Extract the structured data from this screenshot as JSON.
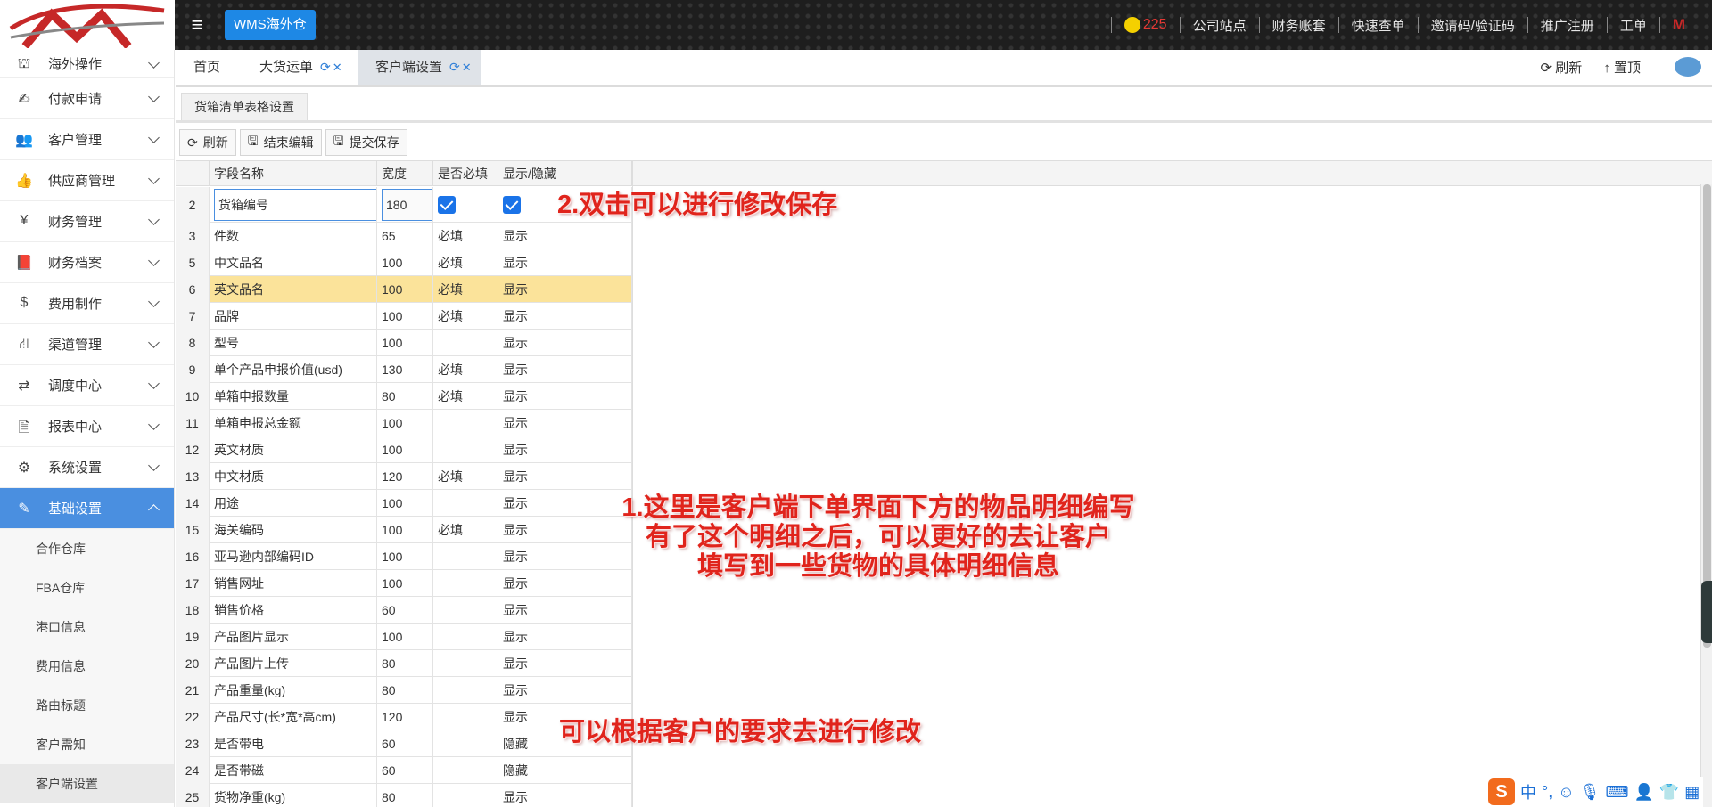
{
  "topbar": {
    "app_badge": "WMS海外仓",
    "notify_count": "225",
    "links": [
      "公司站点",
      "财务账套",
      "快速查单",
      "邀请码/验证码",
      "推广注册",
      "工单"
    ],
    "user_mark": "M"
  },
  "sidebar": {
    "items": [
      {
        "label": "海外操作",
        "icon": "customs-icon"
      },
      {
        "label": "付款申请",
        "icon": "payment-icon"
      },
      {
        "label": "客户管理",
        "icon": "users-icon"
      },
      {
        "label": "供应商管理",
        "icon": "thumbs-up-icon"
      },
      {
        "label": "财务管理",
        "icon": "yen-icon"
      },
      {
        "label": "财务档案",
        "icon": "book-icon"
      },
      {
        "label": "费用制作",
        "icon": "dollar-icon"
      },
      {
        "label": "渠道管理",
        "icon": "road-icon"
      },
      {
        "label": "调度中心",
        "icon": "retweet-icon"
      },
      {
        "label": "报表中心",
        "icon": "file-icon"
      },
      {
        "label": "系统设置",
        "icon": "gear-icon"
      },
      {
        "label": "基础设置",
        "icon": "edit-icon"
      }
    ],
    "subitems": [
      "合作仓库",
      "FBA仓库",
      "港口信息",
      "费用信息",
      "路由标题",
      "客户需知",
      "客户端设置"
    ]
  },
  "tabs": {
    "items": [
      "首页",
      "大货运单",
      "客户端设置"
    ],
    "refresh_label": "刷新",
    "top_label": "置顶"
  },
  "panel": {
    "title": "货箱清单表格设置",
    "toolbar": {
      "refresh": "刷新",
      "end_edit": "结束编辑",
      "save": "提交保存"
    }
  },
  "grid": {
    "headers": [
      "字段名称",
      "宽度",
      "是否必填",
      "显示/隐藏"
    ],
    "edit_row": {
      "num": "2",
      "name": "货箱编号",
      "width": "180",
      "required": true,
      "visible": true
    },
    "rows": [
      {
        "num": "3",
        "name": "件数",
        "width": "65",
        "required": "必填",
        "visible": "显示"
      },
      {
        "num": "5",
        "name": "中文品名",
        "width": "100",
        "required": "必填",
        "visible": "显示"
      },
      {
        "num": "6",
        "name": "英文品名",
        "width": "100",
        "required": "必填",
        "visible": "显示"
      },
      {
        "num": "7",
        "name": "品牌",
        "width": "100",
        "required": "必填",
        "visible": "显示"
      },
      {
        "num": "8",
        "name": "型号",
        "width": "100",
        "required": "",
        "visible": "显示"
      },
      {
        "num": "9",
        "name": "单个产品申报价值(usd)",
        "width": "130",
        "required": "必填",
        "visible": "显示"
      },
      {
        "num": "10",
        "name": "单箱申报数量",
        "width": "80",
        "required": "必填",
        "visible": "显示"
      },
      {
        "num": "11",
        "name": "单箱申报总金额",
        "width": "100",
        "required": "",
        "visible": "显示"
      },
      {
        "num": "12",
        "name": "英文材质",
        "width": "100",
        "required": "",
        "visible": "显示"
      },
      {
        "num": "13",
        "name": "中文材质",
        "width": "120",
        "required": "必填",
        "visible": "显示"
      },
      {
        "num": "14",
        "name": "用途",
        "width": "100",
        "required": "",
        "visible": "显示"
      },
      {
        "num": "15",
        "name": "海关编码",
        "width": "100",
        "required": "必填",
        "visible": "显示"
      },
      {
        "num": "16",
        "name": "亚马逊内部编码ID",
        "width": "100",
        "required": "",
        "visible": "显示"
      },
      {
        "num": "17",
        "name": "销售网址",
        "width": "100",
        "required": "",
        "visible": "显示"
      },
      {
        "num": "18",
        "name": "销售价格",
        "width": "60",
        "required": "",
        "visible": "显示"
      },
      {
        "num": "19",
        "name": "产品图片显示",
        "width": "100",
        "required": "",
        "visible": "显示"
      },
      {
        "num": "20",
        "name": "产品图片上传",
        "width": "80",
        "required": "",
        "visible": "显示"
      },
      {
        "num": "21",
        "name": "产品重量(kg)",
        "width": "80",
        "required": "",
        "visible": "显示"
      },
      {
        "num": "22",
        "name": "产品尺寸(长*宽*高cm)",
        "width": "120",
        "required": "",
        "visible": "显示"
      },
      {
        "num": "23",
        "name": "是否带电",
        "width": "60",
        "required": "",
        "visible": "隐藏"
      },
      {
        "num": "24",
        "name": "是否带磁",
        "width": "60",
        "required": "",
        "visible": "隐藏"
      },
      {
        "num": "25",
        "name": "货物净重(kg)",
        "width": "80",
        "required": "",
        "visible": "显示"
      }
    ]
  },
  "annotations": {
    "a2": "2.双击可以进行修改保存",
    "a1_line1": "1.这里是客户端下单界面下方的物品明细编写",
    "a1_line2": "有了这个明细之后，可以更好的去让客户",
    "a1_line3": "填写到一些货物的具体明细信息",
    "a3": "可以根据客户的要求去进行修改"
  },
  "ime": {
    "mode": "中"
  },
  "colors": {
    "accent": "#4a8fe0",
    "highlight_row": "#fbe39a",
    "annotation": "#e0241c",
    "badge": "#1e88e5"
  }
}
